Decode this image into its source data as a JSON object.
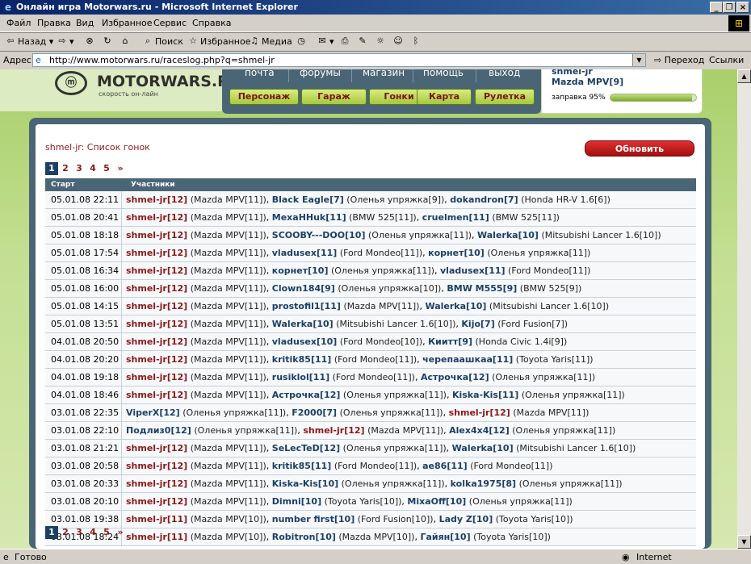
{
  "window": {
    "title": "Онлайн игра Motorwars.ru - Microsoft Internet Explorer"
  },
  "menu": [
    "Файл",
    "Правка",
    "Вид",
    "Избранное",
    "Сервис",
    "Справка"
  ],
  "toolbar": {
    "back": "Назад",
    "search": "Поиск",
    "favorites": "Избранное",
    "media": "Медиа"
  },
  "address": {
    "label": "Адрес:",
    "url": "http://www.motorwars.ru/raceslog.php?q=shmel-jr",
    "go": "Переход",
    "links": "Ссылки"
  },
  "status": {
    "left": "Готово",
    "zone": "Internet"
  },
  "site": {
    "logo": "MOTORWARS.RU",
    "tagline": "скорость он-лайн",
    "topnav": [
      "почта",
      "форумы",
      "магазин",
      "помощь",
      "выход"
    ],
    "buttons": [
      "Персонаж",
      "Гараж",
      "Гонки",
      "Карта",
      "Рулетка"
    ],
    "user": {
      "name": "shmel-jr",
      "car": "Mazda MPV[9]",
      "fuel_label": "заправка 95%",
      "fuel_pct": 95
    }
  },
  "list": {
    "title": "shmel-jr: Список гонок",
    "refresh": "Обновить",
    "pages": [
      "1",
      "2",
      "3",
      "4",
      "5",
      "»"
    ],
    "current_page": "1",
    "col_start": "Старт",
    "col_participants": "Участники",
    "rows": [
      {
        "date": "05.01.08 22:11",
        "p": [
          [
            "shmel-jr",
            "[12]",
            "(Mazda MPV[11])",
            true
          ],
          [
            "Black Eagle",
            "[7]",
            "(Оленья упряжка[9])",
            false
          ],
          [
            "dokandron",
            "[7]",
            "(Honda HR-V 1.6[6])",
            false
          ]
        ]
      },
      {
        "date": "05.01.08 20:41",
        "p": [
          [
            "shmel-jr",
            "[12]",
            "(Mazda MPV[11])",
            true
          ],
          [
            "MexaHHuk",
            "[11]",
            "(BMW 525[11])",
            false
          ],
          [
            "cruelmen",
            "[11]",
            "(BMW 525[11])",
            false
          ]
        ]
      },
      {
        "date": "05.01.08 18:18",
        "p": [
          [
            "shmel-jr",
            "[12]",
            "(Mazda MPV[11])",
            true
          ],
          [
            "SCOOBY---DOO",
            "[10]",
            "(Оленья упряжка[11])",
            false
          ],
          [
            "Walerka",
            "[10]",
            "(Mitsubishi Lancer 1.6[10])",
            false
          ]
        ]
      },
      {
        "date": "05.01.08 17:54",
        "p": [
          [
            "shmel-jr",
            "[12]",
            "(Mazda MPV[11])",
            true
          ],
          [
            "vladusex",
            "[11]",
            "(Ford Mondeo[11])",
            false
          ],
          [
            "корнет",
            "[10]",
            "(Оленья упряжка[11])",
            false
          ]
        ]
      },
      {
        "date": "05.01.08 16:34",
        "p": [
          [
            "shmel-jr",
            "[12]",
            "(Mazda MPV[11])",
            true
          ],
          [
            "корнет",
            "[10]",
            "(Оленья упряжка[11])",
            false
          ],
          [
            "vladusex",
            "[11]",
            "(Ford Mondeo[11])",
            false
          ]
        ]
      },
      {
        "date": "05.01.08 16:00",
        "p": [
          [
            "shmel-jr",
            "[12]",
            "(Mazda MPV[11])",
            true
          ],
          [
            "Clown184",
            "[9]",
            "(Оленья упряжка[10])",
            false
          ],
          [
            "BMW M555",
            "[9]",
            "(BMW 525[9])",
            false
          ]
        ]
      },
      {
        "date": "05.01.08 14:15",
        "p": [
          [
            "shmel-jr",
            "[12]",
            "(Mazda MPV[11])",
            true
          ],
          [
            "prostofil1",
            "[11]",
            "(Mazda MPV[11])",
            false
          ],
          [
            "Walerka",
            "[10]",
            "(Mitsubishi Lancer 1.6[10])",
            false
          ]
        ]
      },
      {
        "date": "05.01.08 13:51",
        "p": [
          [
            "shmel-jr",
            "[12]",
            "(Mazda MPV[11])",
            true
          ],
          [
            "Walerka",
            "[10]",
            "(Mitsubishi Lancer 1.6[10])",
            false
          ],
          [
            "Kijo",
            "[7]",
            "(Ford Fusion[7])",
            false
          ]
        ]
      },
      {
        "date": "04.01.08 20:50",
        "p": [
          [
            "shmel-jr",
            "[12]",
            "(Mazda MPV[11])",
            true
          ],
          [
            "vladusex",
            "[10]",
            "(Ford Mondeo[10])",
            false
          ],
          [
            "Киитт",
            "[9]",
            "(Honda Civic 1.4i[9])",
            false
          ]
        ]
      },
      {
        "date": "04.01.08 20:20",
        "p": [
          [
            "shmel-jr",
            "[12]",
            "(Mazda MPV[11])",
            true
          ],
          [
            "kritik85",
            "[11]",
            "(Ford Mondeo[11])",
            false
          ],
          [
            "черепаашкаа",
            "[11]",
            "(Toyota Yaris[11])",
            false
          ]
        ]
      },
      {
        "date": "04.01.08 19:18",
        "p": [
          [
            "shmel-jr",
            "[12]",
            "(Mazda MPV[11])",
            true
          ],
          [
            "rusiklol",
            "[11]",
            "(Ford Mondeo[11])",
            false
          ],
          [
            "Астрочка",
            "[12]",
            "(Оленья упряжка[11])",
            false
          ]
        ]
      },
      {
        "date": "04.01.08 18:46",
        "p": [
          [
            "shmel-jr",
            "[12]",
            "(Mazda MPV[11])",
            true
          ],
          [
            "Астрочка",
            "[12]",
            "(Оленья упряжка[11])",
            false
          ],
          [
            "Kiska-Kis",
            "[11]",
            "(Оленья упряжка[11])",
            false
          ]
        ]
      },
      {
        "date": "03.01.08 22:35",
        "p": [
          [
            "ViperX",
            "[12]",
            "(Оленья упряжка[11])",
            false
          ],
          [
            "F2000",
            "[7]",
            "(Оленья упряжка[11])",
            false
          ],
          [
            "shmel-jr",
            "[12]",
            "(Mazda MPV[11])",
            true
          ]
        ]
      },
      {
        "date": "03.01.08 22:10",
        "p": [
          [
            "Подлиз0",
            "[12]",
            "(Оленья упряжка[11])",
            false
          ],
          [
            "shmel-jr",
            "[12]",
            "(Mazda MPV[11])",
            true
          ],
          [
            "Alex4x4",
            "[12]",
            "(Оленья упряжка[11])",
            false
          ]
        ]
      },
      {
        "date": "03.01.08 21:21",
        "p": [
          [
            "shmel-jr",
            "[12]",
            "(Mazda MPV[11])",
            true
          ],
          [
            "SeLecTeD",
            "[12]",
            "(Оленья упряжка[11])",
            false
          ],
          [
            "Walerka",
            "[10]",
            "(Mitsubishi Lancer 1.6[10])",
            false
          ]
        ]
      },
      {
        "date": "03.01.08 20:58",
        "p": [
          [
            "shmel-jr",
            "[12]",
            "(Mazda MPV[11])",
            true
          ],
          [
            "kritik85",
            "[11]",
            "(Ford Mondeo[11])",
            false
          ],
          [
            "ae86",
            "[11]",
            "(Ford Mondeo[11])",
            false
          ]
        ]
      },
      {
        "date": "03.01.08 20:33",
        "p": [
          [
            "shmel-jr",
            "[12]",
            "(Mazda MPV[11])",
            true
          ],
          [
            "Kiska-Kis",
            "[10]",
            "(Оленья упряжка[11])",
            false
          ],
          [
            "kolka1975",
            "[8]",
            "(Оленья упряжка[11])",
            false
          ]
        ]
      },
      {
        "date": "03.01.08 20:10",
        "p": [
          [
            "shmel-jr",
            "[12]",
            "(Mazda MPV[11])",
            true
          ],
          [
            "Dimni",
            "[10]",
            "(Toyota Yaris[10])",
            false
          ],
          [
            "MixaOff",
            "[10]",
            "(Оленья упряжка[11])",
            false
          ]
        ]
      },
      {
        "date": "03.01.08 19:38",
        "p": [
          [
            "shmel-jr",
            "[11]",
            "(Mazda MPV[10])",
            true
          ],
          [
            "number first",
            "[10]",
            "(Ford Fusion[10])",
            false
          ],
          [
            "Lady Z",
            "[10]",
            "(Toyota Yaris[10])",
            false
          ]
        ]
      },
      {
        "date": "03.01.08 18:24",
        "p": [
          [
            "shmel-jr",
            "[11]",
            "(Mazda MPV[10])",
            true
          ],
          [
            "Robitron",
            "[10]",
            "(Mazda MPV[10])",
            false
          ],
          [
            "Гайян",
            "[10]",
            "(Toyota Yaris[10])",
            false
          ]
        ]
      }
    ]
  }
}
